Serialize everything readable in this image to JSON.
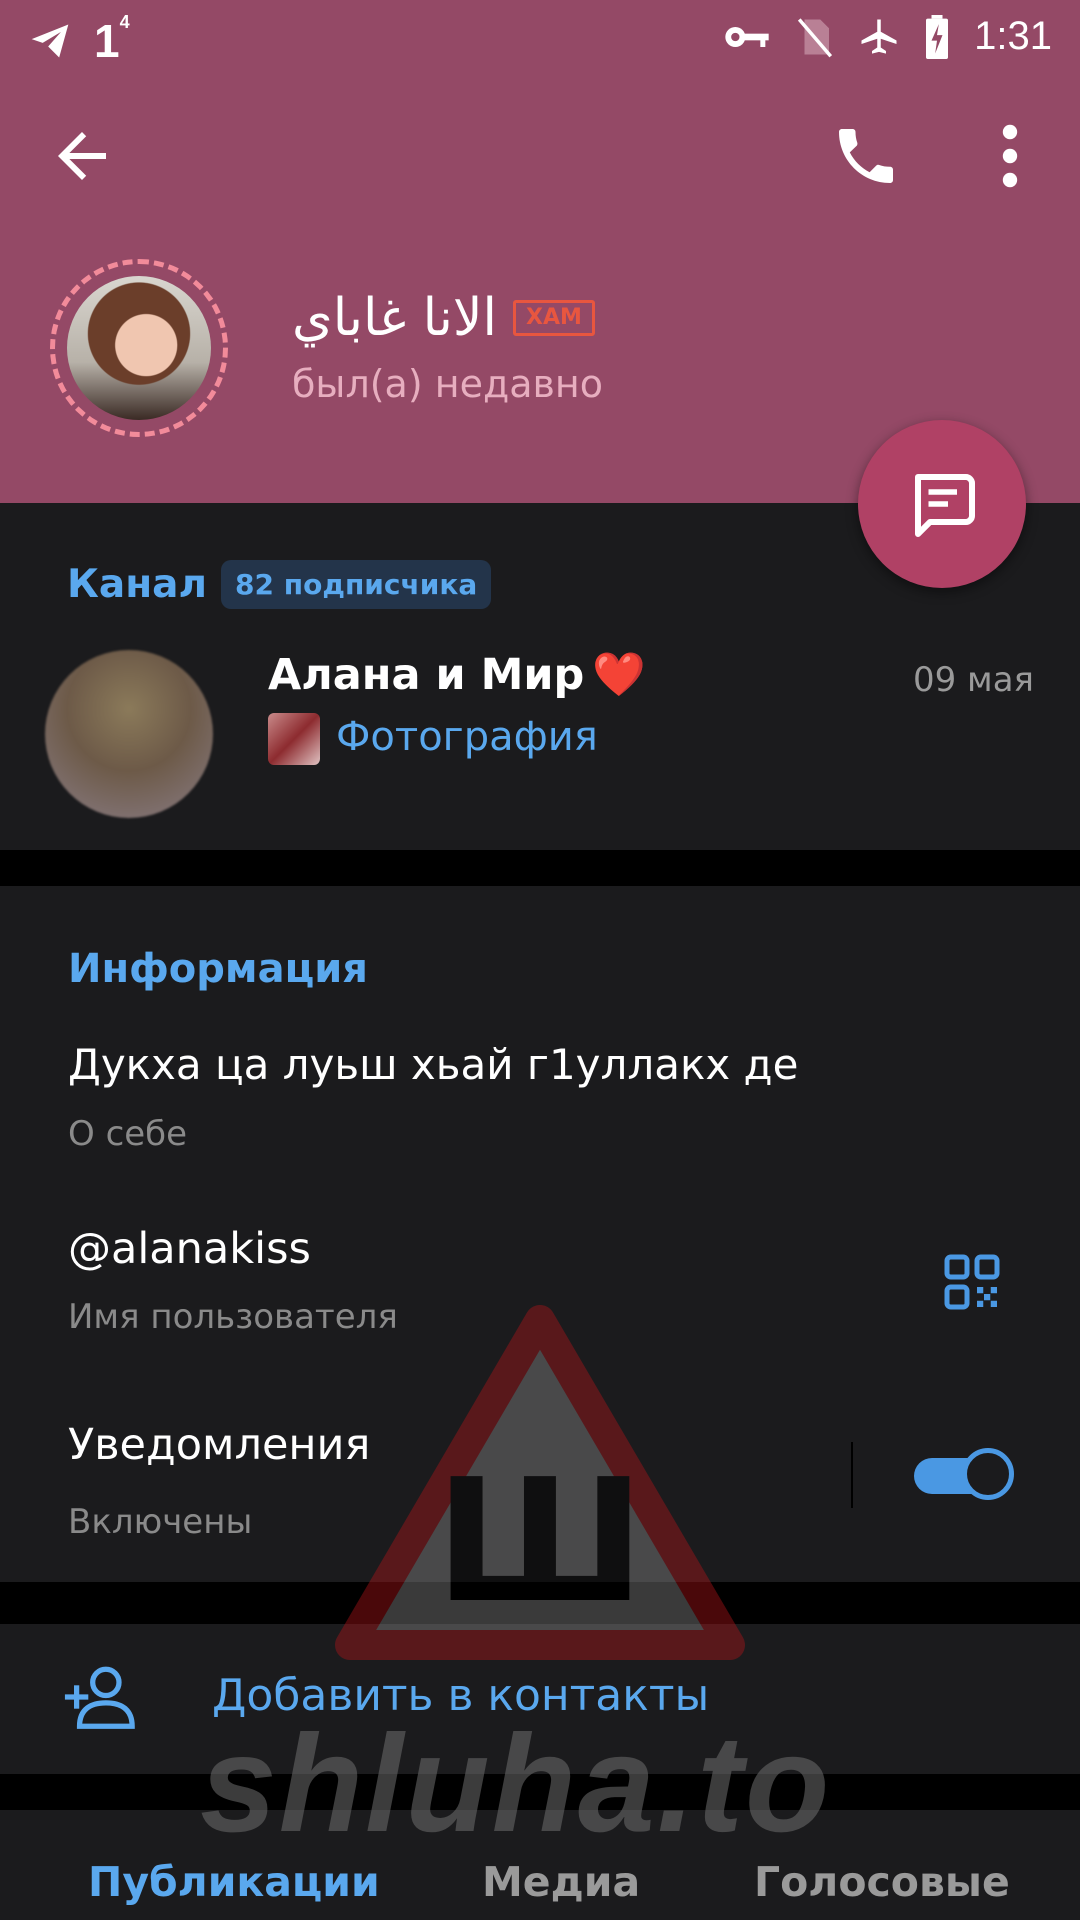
{
  "status_bar": {
    "notification_count": "1",
    "notification_superscript": "4",
    "time": "1:31",
    "icons": [
      "telegram-icon",
      "vpn-key-icon",
      "no-sim-icon",
      "airplane-icon",
      "battery-charging-icon"
    ]
  },
  "header": {
    "profile_name": "الانا غاباي",
    "tag": "ХАМ",
    "status": "был(а) недавно",
    "colors": {
      "background": "#944966",
      "story_ring": "#f28b9a",
      "fab": "#b04165"
    }
  },
  "channel": {
    "section_label": "Канал",
    "subscribers": "82 подписчика",
    "name": "Алана и Мир",
    "emoji": "❤️",
    "date": "09 мая",
    "last_message": "Фотография"
  },
  "info": {
    "title": "Информация",
    "bio": "Дукха ца луьш хьай г1уллакх де",
    "bio_label": "О себе",
    "username": "@alanakiss",
    "username_label": "Имя пользователя",
    "notifications": "Уведомления",
    "notifications_state": "Включены",
    "notifications_enabled": true
  },
  "actions": {
    "add_contact": "Добавить в контакты"
  },
  "tabs": [
    {
      "label": "Публикации",
      "active": true
    },
    {
      "label": "Медиа",
      "active": false
    },
    {
      "label": "Голосовые",
      "active": false
    }
  ],
  "watermark": {
    "text": "shluha.to",
    "glyph": "Ш"
  },
  "accent_color": "#5aa8ee"
}
